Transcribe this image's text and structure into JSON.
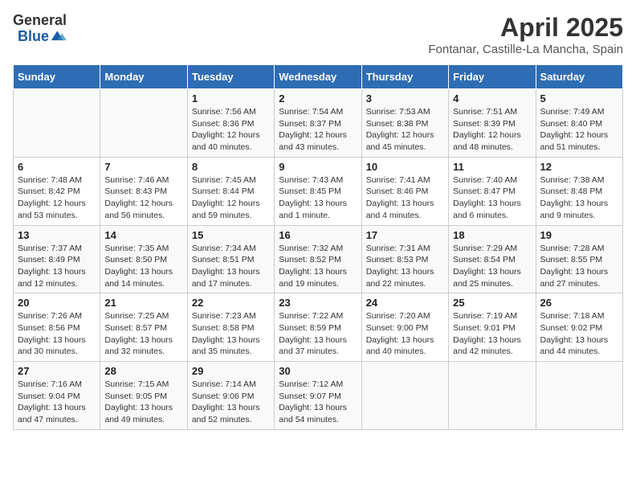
{
  "header": {
    "logo_general": "General",
    "logo_blue": "Blue",
    "title": "April 2025",
    "subtitle": "Fontanar, Castille-La Mancha, Spain"
  },
  "columns": [
    "Sunday",
    "Monday",
    "Tuesday",
    "Wednesday",
    "Thursday",
    "Friday",
    "Saturday"
  ],
  "weeks": [
    [
      {
        "day": "",
        "sunrise": "",
        "sunset": "",
        "daylight": ""
      },
      {
        "day": "",
        "sunrise": "",
        "sunset": "",
        "daylight": ""
      },
      {
        "day": "1",
        "sunrise": "Sunrise: 7:56 AM",
        "sunset": "Sunset: 8:36 PM",
        "daylight": "Daylight: 12 hours and 40 minutes."
      },
      {
        "day": "2",
        "sunrise": "Sunrise: 7:54 AM",
        "sunset": "Sunset: 8:37 PM",
        "daylight": "Daylight: 12 hours and 43 minutes."
      },
      {
        "day": "3",
        "sunrise": "Sunrise: 7:53 AM",
        "sunset": "Sunset: 8:38 PM",
        "daylight": "Daylight: 12 hours and 45 minutes."
      },
      {
        "day": "4",
        "sunrise": "Sunrise: 7:51 AM",
        "sunset": "Sunset: 8:39 PM",
        "daylight": "Daylight: 12 hours and 48 minutes."
      },
      {
        "day": "5",
        "sunrise": "Sunrise: 7:49 AM",
        "sunset": "Sunset: 8:40 PM",
        "daylight": "Daylight: 12 hours and 51 minutes."
      }
    ],
    [
      {
        "day": "6",
        "sunrise": "Sunrise: 7:48 AM",
        "sunset": "Sunset: 8:42 PM",
        "daylight": "Daylight: 12 hours and 53 minutes."
      },
      {
        "day": "7",
        "sunrise": "Sunrise: 7:46 AM",
        "sunset": "Sunset: 8:43 PM",
        "daylight": "Daylight: 12 hours and 56 minutes."
      },
      {
        "day": "8",
        "sunrise": "Sunrise: 7:45 AM",
        "sunset": "Sunset: 8:44 PM",
        "daylight": "Daylight: 12 hours and 59 minutes."
      },
      {
        "day": "9",
        "sunrise": "Sunrise: 7:43 AM",
        "sunset": "Sunset: 8:45 PM",
        "daylight": "Daylight: 13 hours and 1 minute."
      },
      {
        "day": "10",
        "sunrise": "Sunrise: 7:41 AM",
        "sunset": "Sunset: 8:46 PM",
        "daylight": "Daylight: 13 hours and 4 minutes."
      },
      {
        "day": "11",
        "sunrise": "Sunrise: 7:40 AM",
        "sunset": "Sunset: 8:47 PM",
        "daylight": "Daylight: 13 hours and 6 minutes."
      },
      {
        "day": "12",
        "sunrise": "Sunrise: 7:38 AM",
        "sunset": "Sunset: 8:48 PM",
        "daylight": "Daylight: 13 hours and 9 minutes."
      }
    ],
    [
      {
        "day": "13",
        "sunrise": "Sunrise: 7:37 AM",
        "sunset": "Sunset: 8:49 PM",
        "daylight": "Daylight: 13 hours and 12 minutes."
      },
      {
        "day": "14",
        "sunrise": "Sunrise: 7:35 AM",
        "sunset": "Sunset: 8:50 PM",
        "daylight": "Daylight: 13 hours and 14 minutes."
      },
      {
        "day": "15",
        "sunrise": "Sunrise: 7:34 AM",
        "sunset": "Sunset: 8:51 PM",
        "daylight": "Daylight: 13 hours and 17 minutes."
      },
      {
        "day": "16",
        "sunrise": "Sunrise: 7:32 AM",
        "sunset": "Sunset: 8:52 PM",
        "daylight": "Daylight: 13 hours and 19 minutes."
      },
      {
        "day": "17",
        "sunrise": "Sunrise: 7:31 AM",
        "sunset": "Sunset: 8:53 PM",
        "daylight": "Daylight: 13 hours and 22 minutes."
      },
      {
        "day": "18",
        "sunrise": "Sunrise: 7:29 AM",
        "sunset": "Sunset: 8:54 PM",
        "daylight": "Daylight: 13 hours and 25 minutes."
      },
      {
        "day": "19",
        "sunrise": "Sunrise: 7:28 AM",
        "sunset": "Sunset: 8:55 PM",
        "daylight": "Daylight: 13 hours and 27 minutes."
      }
    ],
    [
      {
        "day": "20",
        "sunrise": "Sunrise: 7:26 AM",
        "sunset": "Sunset: 8:56 PM",
        "daylight": "Daylight: 13 hours and 30 minutes."
      },
      {
        "day": "21",
        "sunrise": "Sunrise: 7:25 AM",
        "sunset": "Sunset: 8:57 PM",
        "daylight": "Daylight: 13 hours and 32 minutes."
      },
      {
        "day": "22",
        "sunrise": "Sunrise: 7:23 AM",
        "sunset": "Sunset: 8:58 PM",
        "daylight": "Daylight: 13 hours and 35 minutes."
      },
      {
        "day": "23",
        "sunrise": "Sunrise: 7:22 AM",
        "sunset": "Sunset: 8:59 PM",
        "daylight": "Daylight: 13 hours and 37 minutes."
      },
      {
        "day": "24",
        "sunrise": "Sunrise: 7:20 AM",
        "sunset": "Sunset: 9:00 PM",
        "daylight": "Daylight: 13 hours and 40 minutes."
      },
      {
        "day": "25",
        "sunrise": "Sunrise: 7:19 AM",
        "sunset": "Sunset: 9:01 PM",
        "daylight": "Daylight: 13 hours and 42 minutes."
      },
      {
        "day": "26",
        "sunrise": "Sunrise: 7:18 AM",
        "sunset": "Sunset: 9:02 PM",
        "daylight": "Daylight: 13 hours and 44 minutes."
      }
    ],
    [
      {
        "day": "27",
        "sunrise": "Sunrise: 7:16 AM",
        "sunset": "Sunset: 9:04 PM",
        "daylight": "Daylight: 13 hours and 47 minutes."
      },
      {
        "day": "28",
        "sunrise": "Sunrise: 7:15 AM",
        "sunset": "Sunset: 9:05 PM",
        "daylight": "Daylight: 13 hours and 49 minutes."
      },
      {
        "day": "29",
        "sunrise": "Sunrise: 7:14 AM",
        "sunset": "Sunset: 9:06 PM",
        "daylight": "Daylight: 13 hours and 52 minutes."
      },
      {
        "day": "30",
        "sunrise": "Sunrise: 7:12 AM",
        "sunset": "Sunset: 9:07 PM",
        "daylight": "Daylight: 13 hours and 54 minutes."
      },
      {
        "day": "",
        "sunrise": "",
        "sunset": "",
        "daylight": ""
      },
      {
        "day": "",
        "sunrise": "",
        "sunset": "",
        "daylight": ""
      },
      {
        "day": "",
        "sunrise": "",
        "sunset": "",
        "daylight": ""
      }
    ]
  ]
}
